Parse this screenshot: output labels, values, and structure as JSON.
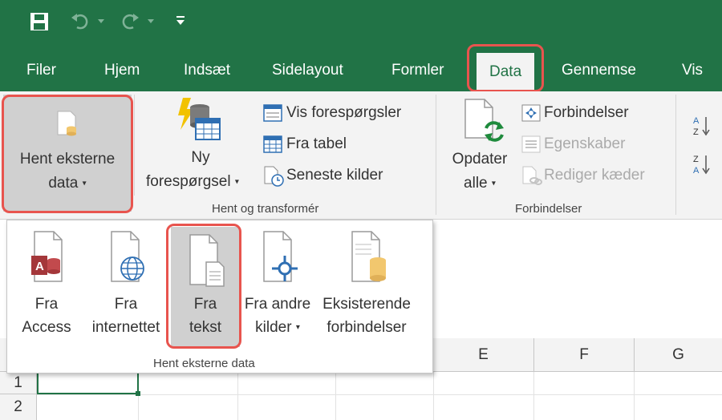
{
  "tabs": [
    "Filer",
    "Hjem",
    "Indsæt",
    "Sidelayout",
    "Formler",
    "Data",
    "Gennemse",
    "Vis"
  ],
  "active_tab": "Data",
  "ribbon": {
    "hent_eksterne_data": {
      "line1": "Hent eksterne",
      "line2": "data"
    },
    "ny_forespoergsel": {
      "line1": "Ny",
      "line2": "forespørgsel"
    },
    "vis_forespoergsler": "Vis forespørgsler",
    "fra_tabel": "Fra tabel",
    "seneste_kilder": "Seneste kilder",
    "group_hent_transformer": "Hent og transformér",
    "opdater_alle": {
      "line1": "Opdater",
      "line2": "alle"
    },
    "forbindelser": "Forbindelser",
    "egenskaber": "Egenskaber",
    "rediger_kaeder": "Rediger kæder",
    "group_forbindelser": "Forbindelser"
  },
  "dropdown": {
    "items": [
      {
        "line1": "Fra",
        "line2": "Access"
      },
      {
        "line1": "Fra",
        "line2": "internettet"
      },
      {
        "line1": "Fra",
        "line2": "tekst"
      },
      {
        "line1": "Fra andre",
        "line2": "kilder"
      },
      {
        "line1": "Eksisterende",
        "line2": "forbindelser"
      }
    ],
    "group_label": "Hent eksterne data"
  },
  "sheet": {
    "columns": [
      "E",
      "F",
      "G"
    ],
    "rows": [
      "1",
      "2"
    ]
  },
  "colors": {
    "accent": "#217346",
    "highlight": "#e8544e",
    "access": "#a4373a"
  }
}
